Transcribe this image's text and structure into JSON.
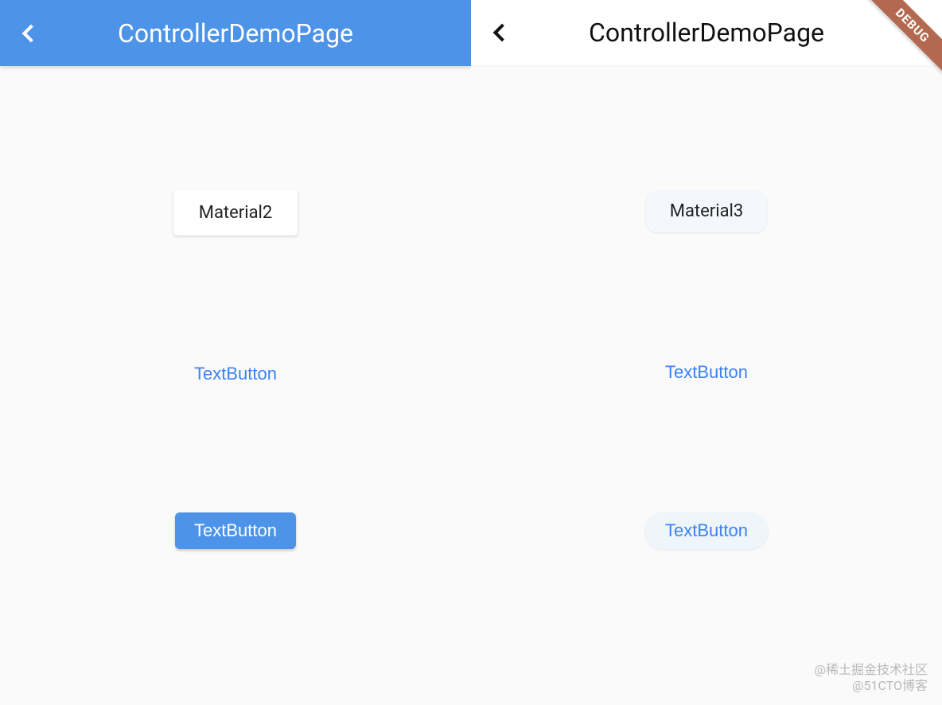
{
  "left": {
    "appbar": {
      "title": "ControllerDemoPage"
    },
    "card_label": "Material2",
    "text_button_label": "TextButton",
    "filled_button_label": "TextButton"
  },
  "right": {
    "appbar": {
      "title": "ControllerDemoPage"
    },
    "card_label": "Material3",
    "text_button_label": "TextButton",
    "tonal_button_label": "TextButton",
    "debug_banner": "DEBUG"
  },
  "watermark": {
    "line1": "@稀土掘金技术社区",
    "line2": "@51CTO博客"
  },
  "colors": {
    "m2_primary": "#4d93e8",
    "m3_surface": "#f4f8fc",
    "text_button": "#3b82f6"
  }
}
